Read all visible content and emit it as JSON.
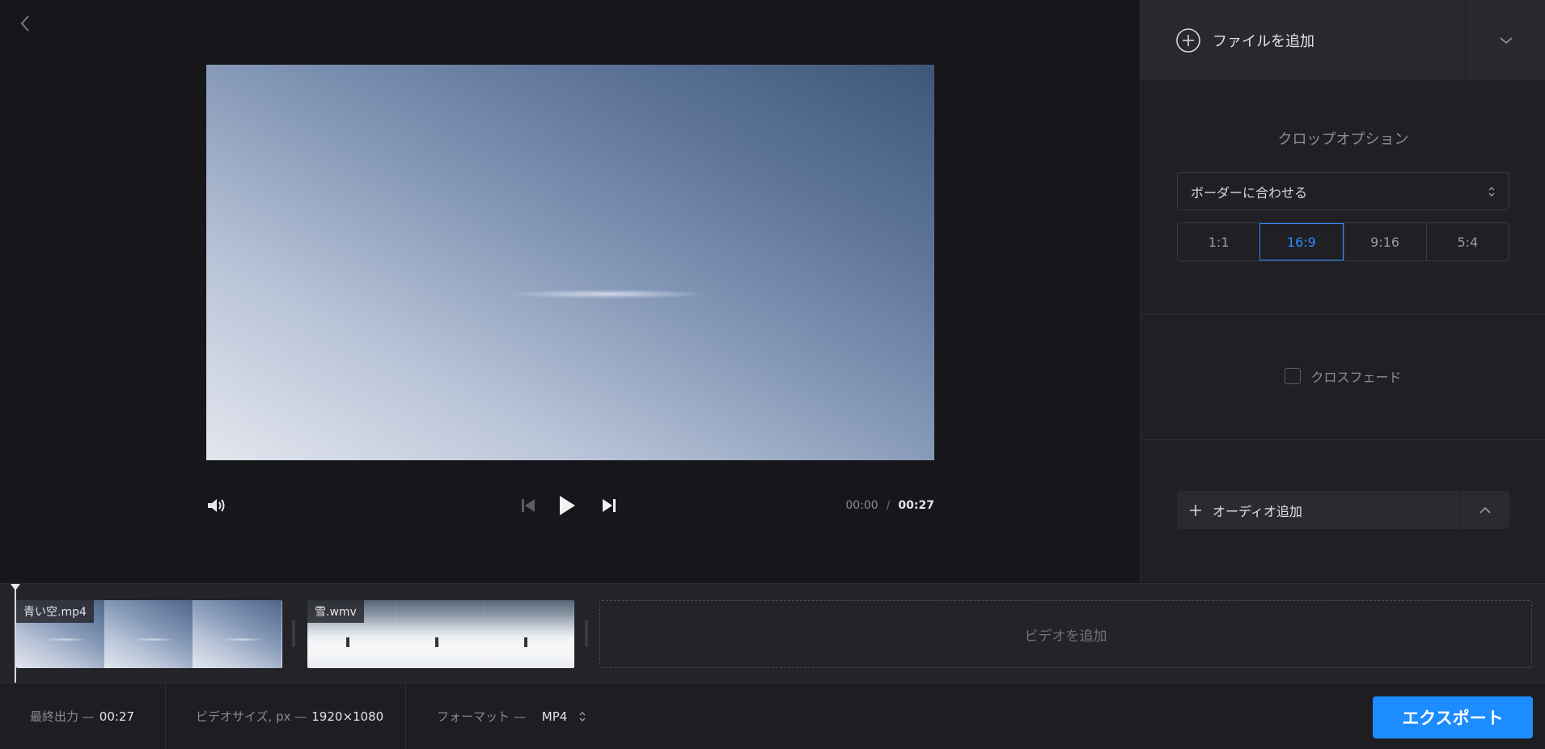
{
  "icons": {
    "back": "chevron-left-icon",
    "add_file": "plus-circle-icon",
    "dropdown": "chevron-down-icon",
    "select_arrows": "updown-arrows-icon",
    "volume": "volume-icon",
    "prev": "skip-previous-icon",
    "play": "play-icon",
    "next": "skip-next-icon",
    "audio_add": "plus-icon",
    "audio_dd": "chevron-up-icon"
  },
  "colors": {
    "accent": "#1c8cff",
    "active_ratio": "#2f8cff",
    "background": "#17171b",
    "panel": "#1f1f24"
  },
  "player": {
    "current_time": "00:00",
    "separator": "/",
    "duration": "00:27"
  },
  "panel": {
    "add_file_label": "ファイルを追加",
    "crop_title": "クロップオプション",
    "crop_select_value": "ボーダーに合わせる",
    "ratios": [
      {
        "label": "1:1",
        "active": false
      },
      {
        "label": "16:9",
        "active": true
      },
      {
        "label": "9:16",
        "active": false
      },
      {
        "label": "5:4",
        "active": false
      }
    ],
    "crossfade_label": "クロスフェード",
    "crossfade_checked": false,
    "audio_add_label": "オーディオ追加"
  },
  "timeline": {
    "clips": [
      {
        "name": "青い空.mp4"
      },
      {
        "name": "雪.wmv"
      }
    ],
    "add_video_label": "ビデオを追加"
  },
  "footer": {
    "final_output_label": "最終出力 —",
    "final_output_value": "00:27",
    "video_size_label": "ビデオサイズ, px —",
    "video_size_value": "1920×1080",
    "format_label": "フォーマット —",
    "format_value": "MP4",
    "export_label": "エクスポート"
  }
}
